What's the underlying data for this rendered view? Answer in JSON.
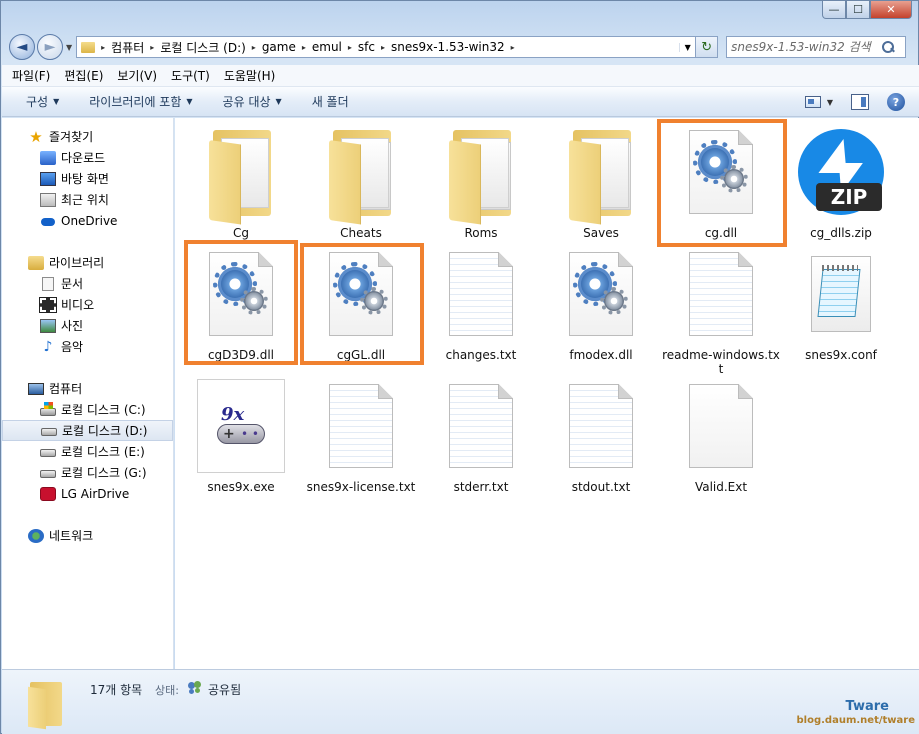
{
  "window": {
    "minimize_glyph": "—",
    "maximize_glyph": "☐",
    "close_glyph": "✕"
  },
  "nav": {
    "back_glyph": "◄",
    "forward_glyph": "►",
    "dropdown_glyph": "▼",
    "refresh_glyph": "↻"
  },
  "address": {
    "breadcrumbs": [
      "컴퓨터",
      "로컬 디스크 (D:)",
      "game",
      "emul",
      "sfc",
      "snes9x-1.53-win32"
    ],
    "separator": "▸",
    "dropdown_glyph": "▼"
  },
  "search": {
    "placeholder": "snes9x-1.53-win32 검색"
  },
  "menubar": {
    "items": [
      "파일(F)",
      "편집(E)",
      "보기(V)",
      "도구(T)",
      "도움말(H)"
    ]
  },
  "commandbar": {
    "items": [
      {
        "label": "구성",
        "arrow": "▼"
      },
      {
        "label": "라이브러리에 포함",
        "arrow": "▼"
      },
      {
        "label": "공유 대상",
        "arrow": "▼"
      },
      {
        "label": "새 폴더",
        "arrow": ""
      }
    ],
    "view_arrow": "▼",
    "help_glyph": "?"
  },
  "navpane": {
    "favorites": {
      "label": "즐겨찾기",
      "icon": "star-icon",
      "glyph": "★",
      "items": [
        {
          "label": "다운로드",
          "icon": "downloads-icon"
        },
        {
          "label": "바탕 화면",
          "icon": "desktop-icon"
        },
        {
          "label": "최근 위치",
          "icon": "recent-places-icon"
        },
        {
          "label": "OneDrive",
          "icon": "onedrive-icon"
        }
      ]
    },
    "libraries": {
      "label": "라이브러리",
      "icon": "library-icon",
      "items": [
        {
          "label": "문서",
          "icon": "documents-icon"
        },
        {
          "label": "비디오",
          "icon": "video-icon"
        },
        {
          "label": "사진",
          "icon": "pictures-icon"
        },
        {
          "label": "음악",
          "icon": "music-icon",
          "glyph": "♪"
        }
      ]
    },
    "computer": {
      "label": "컴퓨터",
      "icon": "computer-icon",
      "items": [
        {
          "label": "로컬 디스크 (C:)",
          "icon": "system-drive-icon"
        },
        {
          "label": "로컬 디스크 (D:)",
          "icon": "drive-icon",
          "selected": true
        },
        {
          "label": "로컬 디스크 (E:)",
          "icon": "drive-icon"
        },
        {
          "label": "로컬 디스크 (G:)",
          "icon": "drive-icon"
        },
        {
          "label": "LG AirDrive",
          "icon": "lg-airdrive-icon"
        }
      ]
    },
    "network": {
      "label": "네트워크",
      "icon": "network-icon"
    }
  },
  "files": [
    {
      "name": "Cg",
      "type": "folder"
    },
    {
      "name": "Cheats",
      "type": "folder"
    },
    {
      "name": "Roms",
      "type": "folder"
    },
    {
      "name": "Saves",
      "type": "folder"
    },
    {
      "name": "cg.dll",
      "type": "dll",
      "highlighted": true,
      "selected": true
    },
    {
      "name": "cg_dlls.zip",
      "type": "zip",
      "badge": "ZIP"
    },
    {
      "name": "cgD3D9.dll",
      "type": "dll",
      "highlighted": true
    },
    {
      "name": "cgGL.dll",
      "type": "dll",
      "highlighted": true
    },
    {
      "name": "changes.txt",
      "type": "txt"
    },
    {
      "name": "fmodex.dll",
      "type": "dll"
    },
    {
      "name": "readme-windows.txt",
      "type": "txt"
    },
    {
      "name": "snes9x.conf",
      "type": "conf"
    },
    {
      "name": "snes9x.exe",
      "type": "exe",
      "logo_text": "9x"
    },
    {
      "name": "snes9x-license.txt",
      "type": "txt"
    },
    {
      "name": "stderr.txt",
      "type": "txt"
    },
    {
      "name": "stdout.txt",
      "type": "txt"
    },
    {
      "name": "Valid.Ext",
      "type": "blank"
    }
  ],
  "highlight_color": "#f0812f",
  "details": {
    "count": "17개 항목",
    "state_label": "상태:",
    "state_value": "공유됨"
  },
  "watermark": {
    "line1": "Tware",
    "line2": "blog.daum.net/tware"
  }
}
